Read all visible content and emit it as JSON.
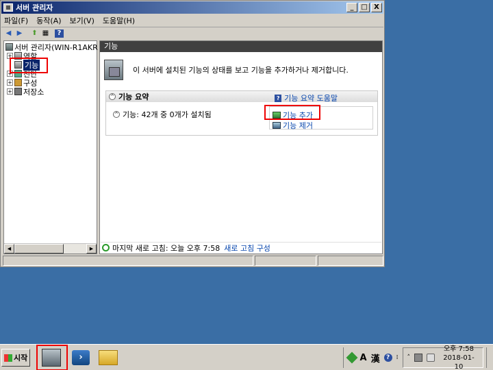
{
  "window": {
    "title": "서버 관리자",
    "buttons": {
      "minimize": "_",
      "maximize": "□",
      "close": "X"
    }
  },
  "menu": [
    "파일(F)",
    "동작(A)",
    "보기(V)",
    "도움말(H)"
  ],
  "toolbar": {
    "back": "◀",
    "forward": "▶",
    "up": "⬆",
    "view": "▦",
    "help": "?"
  },
  "tree": {
    "root": "서버 관리자(WIN-R1AKR",
    "items": [
      {
        "label": "역할",
        "expander": "+"
      },
      {
        "label": "기능",
        "expander": ""
      },
      {
        "label": "진단",
        "expander": "+"
      },
      {
        "label": "구성",
        "expander": "+"
      },
      {
        "label": "저장소",
        "expander": "+"
      }
    ],
    "scroll_left": "◀",
    "scroll_right": "▶"
  },
  "content": {
    "header": "기능",
    "intro": "이 서버에 설치된 기능의 상태를 보고 기능을 추가하거나 제거합니다.",
    "section": {
      "toggle": "^",
      "title": "기능 요약",
      "help_icon": "?",
      "help_link": "기능 요약 도움말",
      "summary_toggle": "^",
      "summary": "기능: 42개 중 0개가 설치됨",
      "actions": {
        "add": "기능 추가",
        "remove": "기능 제거"
      }
    },
    "status": {
      "refresh_text": "마지막 새로 고침: 오늘 오후 7:58",
      "refresh_link": "새로 고침 구성"
    }
  },
  "taskbar": {
    "start": "시작",
    "powershell_glyph": "›",
    "ime": {
      "alpha": "A",
      "hanja": "漢",
      "help": "?"
    },
    "tray_expand": "˄",
    "clock": {
      "time": "오후 7:58",
      "date": "2018-01-10"
    }
  },
  "colors": {
    "highlight": "#e00000",
    "link": "#0645ad",
    "selection": "#0a246a"
  }
}
